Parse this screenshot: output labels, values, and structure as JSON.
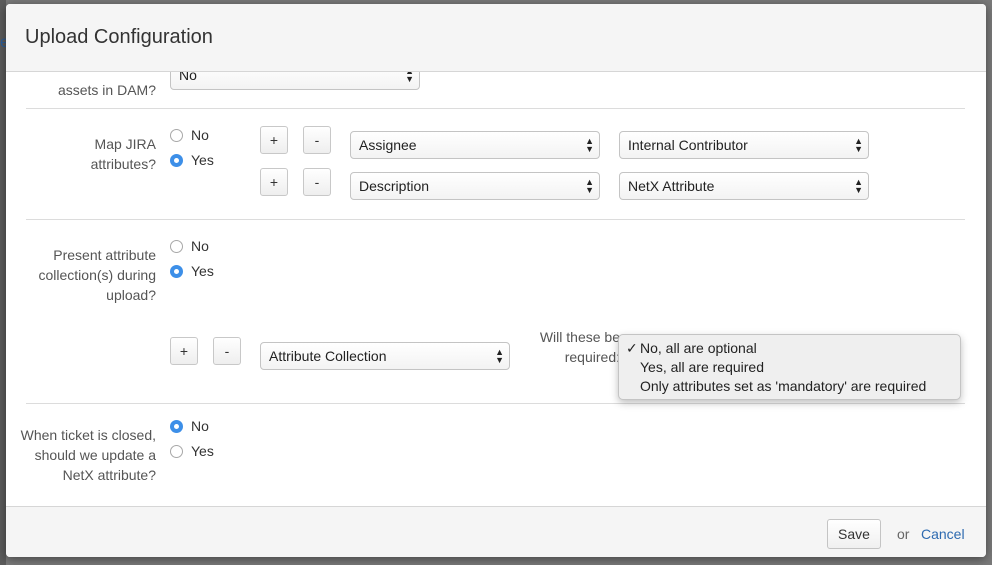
{
  "backdrop": {
    "edge_char": "e"
  },
  "dialog": {
    "title": "Upload Configuration"
  },
  "assets_section": {
    "label": "assets in DAM?",
    "select_value": "No"
  },
  "jira_section": {
    "label": "Map JIRA attributes?",
    "options": [
      "No",
      "Yes"
    ],
    "selected": "Yes",
    "plus_label": "+",
    "minus_label": "-",
    "mappings": [
      {
        "jira_attribute": "Assignee",
        "netx_attribute": "Internal Contributor"
      },
      {
        "jira_attribute": "Description",
        "netx_attribute": "NetX Attribute"
      }
    ]
  },
  "collection_section": {
    "label": "Present attribute collection(s) during upload?",
    "options": [
      "No",
      "Yes"
    ],
    "selected": "Yes",
    "plus_label": "+",
    "minus_label": "-",
    "collection_select": "Attribute Collection",
    "required_label": "Will these be required:",
    "required_options": [
      "No, all are optional",
      "Yes, all are required",
      "Only attributes set as 'mandatory' are required"
    ],
    "required_selected": "No, all are optional",
    "check_mark": "✓"
  },
  "ticket_section": {
    "label": "When ticket is closed, should we update a NetX attribute?",
    "options": [
      "No",
      "Yes"
    ],
    "selected": "No"
  },
  "footer": {
    "save_label": "Save",
    "or_text": "or",
    "cancel_label": "Cancel"
  },
  "colors": {
    "accent": "#3d8fe8",
    "link": "#2d6ab0",
    "header_bg": "#f5f5f5"
  }
}
